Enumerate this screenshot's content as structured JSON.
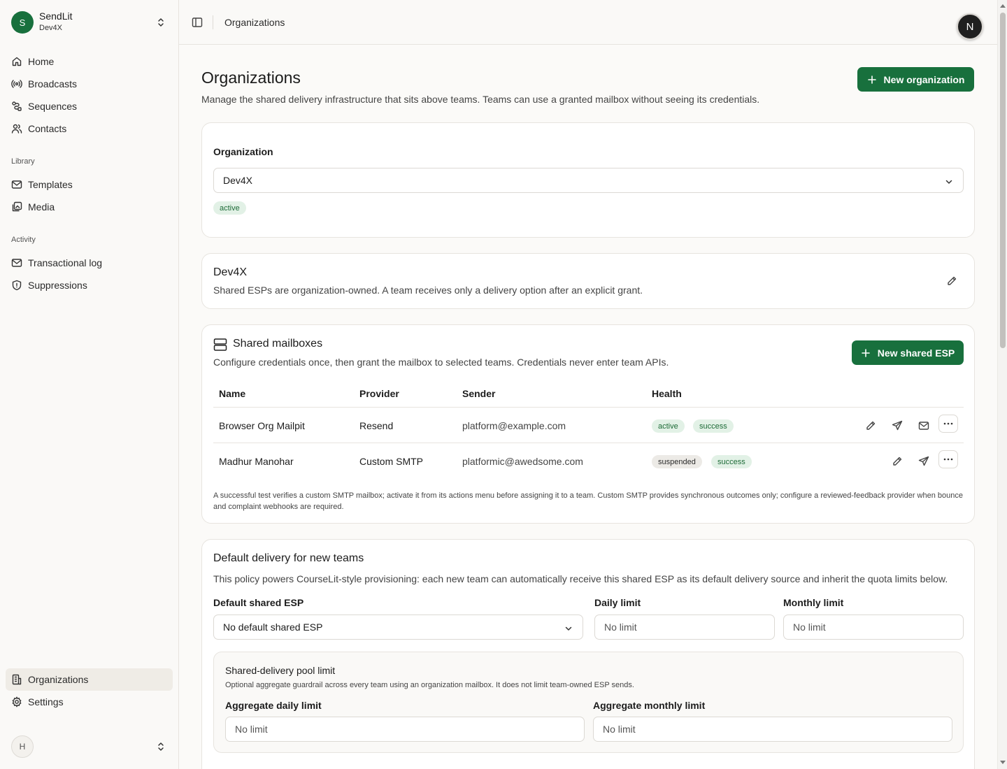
{
  "workspace": {
    "initial": "S",
    "name": "SendLit",
    "sub": "Dev4X"
  },
  "nav": {
    "main": [
      {
        "label": "Home",
        "icon": "home-icon"
      },
      {
        "label": "Broadcasts",
        "icon": "broadcast-icon"
      },
      {
        "label": "Sequences",
        "icon": "sequence-icon"
      },
      {
        "label": "Contacts",
        "icon": "contacts-icon"
      }
    ],
    "library_label": "Library",
    "library": [
      {
        "label": "Templates",
        "icon": "mail-icon"
      },
      {
        "label": "Media",
        "icon": "media-icon"
      }
    ],
    "activity_label": "Activity",
    "activity": [
      {
        "label": "Transactional log",
        "icon": "mail-icon"
      },
      {
        "label": "Suppressions",
        "icon": "shield-icon"
      }
    ],
    "bottom": [
      {
        "label": "Organizations",
        "icon": "building-icon"
      },
      {
        "label": "Settings",
        "icon": "gear-icon"
      }
    ]
  },
  "user": {
    "initial": "H"
  },
  "header": {
    "title": "Organizations",
    "avatar": "N"
  },
  "page": {
    "title": "Organizations",
    "description": "Manage the shared delivery infrastructure that sits above teams. Teams can use a granted mailbox without seeing its credentials.",
    "new_org_button": "New organization"
  },
  "org_select": {
    "label": "Organization",
    "value": "Dev4X",
    "status": "active"
  },
  "org_info": {
    "name": "Dev4X",
    "description": "Shared ESPs are organization-owned. A team receives only a delivery option after an explicit grant."
  },
  "mailboxes": {
    "title": "Shared mailboxes",
    "description": "Configure credentials once, then grant the mailbox to selected teams. Credentials never enter team APIs.",
    "new_button": "New shared ESP",
    "columns": [
      "Name",
      "Provider",
      "Sender",
      "Health"
    ],
    "rows": [
      {
        "name": "Browser Org Mailpit",
        "provider": "Resend",
        "sender": "platform@example.com",
        "status": "active",
        "health": "success"
      },
      {
        "name": "Madhur Manohar",
        "provider": "Custom SMTP",
        "sender": "platformic@awedsome.com",
        "status": "suspended",
        "health": "success"
      }
    ],
    "note": "A successful test verifies a custom SMTP mailbox; activate it from its actions menu before assigning it to a team. Custom SMTP provides synchronous outcomes only; configure a reviewed-feedback provider when bounce and complaint webhooks are required."
  },
  "default_delivery": {
    "title": "Default delivery for new teams",
    "description": "This policy powers CourseLit-style provisioning: each new team can automatically receive this shared ESP as its default delivery source and inherit the quota limits below.",
    "esp_label": "Default shared ESP",
    "esp_value": "No default shared ESP",
    "daily_label": "Daily limit",
    "daily_placeholder": "No limit",
    "monthly_label": "Monthly limit",
    "monthly_placeholder": "No limit",
    "pool": {
      "title": "Shared-delivery pool limit",
      "description": "Optional aggregate guardrail across every team using an organization mailbox. It does not limit team-owned ESP sends.",
      "daily_label": "Aggregate daily limit",
      "daily_placeholder": "No limit",
      "monthly_label": "Aggregate monthly limit",
      "monthly_placeholder": "No limit"
    }
  }
}
